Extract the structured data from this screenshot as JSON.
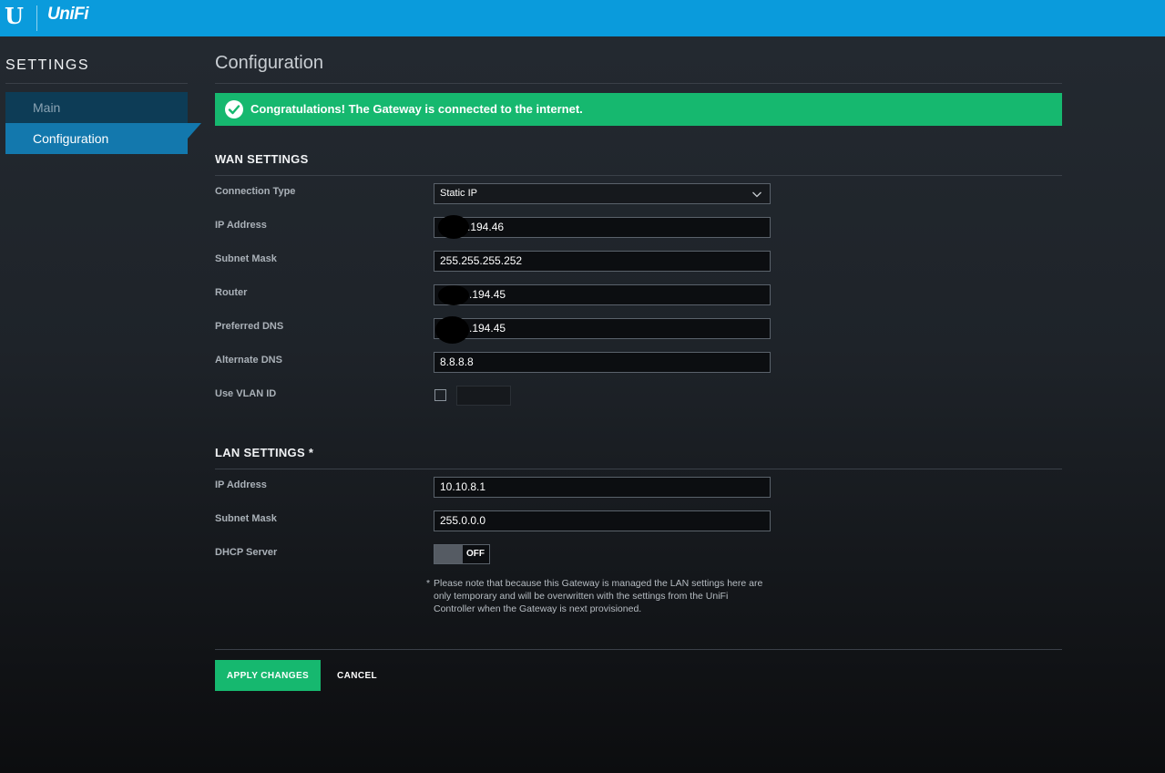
{
  "brand": {
    "logo_letter": "U",
    "logo_text": "UniFi",
    "bar_color": "#0a9bdc"
  },
  "sidebar": {
    "title": "SETTINGS",
    "items": [
      {
        "label": "Main",
        "active": false
      },
      {
        "label": "Configuration",
        "active": true
      }
    ]
  },
  "page": {
    "title": "Configuration"
  },
  "banner": {
    "text": "Congratulations! The Gateway is connected to the internet.",
    "color": "#16b86f",
    "icon": "check-circle-icon"
  },
  "wan": {
    "title": "WAN SETTINGS",
    "connection_type": {
      "label": "Connection Type",
      "value": "Static IP"
    },
    "ip_address": {
      "label": "IP Address",
      "value": ".194.46"
    },
    "subnet_mask": {
      "label": "Subnet Mask",
      "value": "255.255.255.252"
    },
    "router": {
      "label": "Router",
      "value": ".194.45"
    },
    "preferred_dns": {
      "label": "Preferred DNS",
      "value": ".194.45"
    },
    "alternate_dns": {
      "label": "Alternate DNS",
      "value": "8.8.8.8"
    },
    "vlan": {
      "label": "Use VLAN ID",
      "checked": false,
      "value": ""
    }
  },
  "lan": {
    "title": "LAN SETTINGS *",
    "ip_address": {
      "label": "IP Address",
      "value": "10.10.8.1"
    },
    "subnet_mask": {
      "label": "Subnet Mask",
      "value": "255.0.0.0"
    },
    "dhcp": {
      "label": "DHCP Server",
      "state": "OFF"
    },
    "note": {
      "star": "*",
      "lines": [
        "Please note that because this Gateway is managed the LAN settings here are",
        "only temporary and will be overwritten with the settings from the UniFi",
        "Controller when the Gateway is next provisioned."
      ]
    }
  },
  "actions": {
    "apply": "APPLY CHANGES",
    "cancel": "CANCEL"
  }
}
